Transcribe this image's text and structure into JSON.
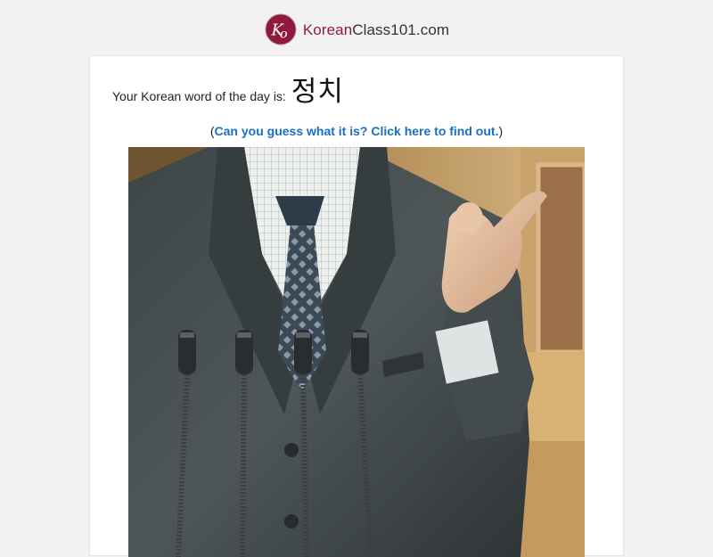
{
  "header": {
    "brand_korean": "Korean",
    "brand_rest": "Class101.com",
    "logo_initials": "KO",
    "brand_color": "#8e1b3d"
  },
  "wotd": {
    "label": "Your Korean word of the day is:",
    "word": "정치"
  },
  "guess": {
    "open_paren": "(",
    "link_text": "Can you guess what it is? Click here to find out.",
    "close_paren": ")"
  },
  "photo": {
    "icon": "politician-speaking-at-microphones-photo"
  }
}
